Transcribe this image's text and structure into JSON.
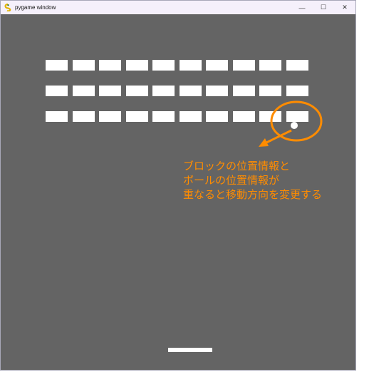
{
  "window": {
    "title": "pygame window",
    "minimize_label": "—",
    "maximize_label": "☐",
    "close_label": "✕",
    "icon": "pygame-snake-icon"
  },
  "game": {
    "background_color": "#646464",
    "brick_color": "#ffffff",
    "brick_rows": 3,
    "brick_columns": 10,
    "ball_color": "#ffffff",
    "paddle_color": "#ffffff"
  },
  "annotation": {
    "color": "#ff8c00",
    "lines": [
      "ブロックの位置情報と",
      "ボールの位置情報が",
      "重なると移動方向を変更する"
    ]
  }
}
